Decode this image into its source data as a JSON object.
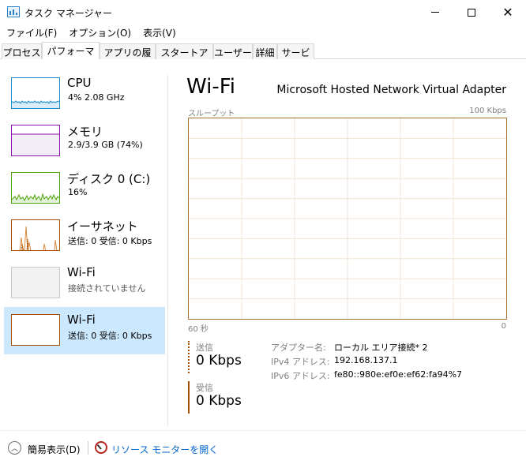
{
  "window": {
    "title": "タスク マネージャー",
    "icon": "task-manager-icon",
    "controls": {
      "minimize": "minimize-icon",
      "maximize": "maximize-icon",
      "close": "close-icon",
      "close_glyph": "✕"
    }
  },
  "menu": [
    {
      "label": "ファイル(F)"
    },
    {
      "label": "オプション(O)"
    },
    {
      "label": "表示(V)"
    }
  ],
  "tabs": [
    {
      "label": "プロセス",
      "active": false
    },
    {
      "label": "パフォーマンス",
      "active": true
    },
    {
      "label": "アプリの履歴",
      "active": false
    },
    {
      "label": "スタートアップ",
      "active": false
    },
    {
      "label": "ユーザー",
      "active": false
    },
    {
      "label": "詳細",
      "active": false
    },
    {
      "label": "サービス",
      "active": false
    }
  ],
  "sidebar": {
    "items": [
      {
        "title": "CPU",
        "subtitle": "4%  2.08 GHz",
        "color": "#1e8ecb",
        "selected": false
      },
      {
        "title": "メモリ",
        "subtitle": "2.9/3.9 GB (74%)",
        "color": "#8b12ae",
        "selected": false
      },
      {
        "title": "ディスク 0 (C:)",
        "subtitle": "16%",
        "color": "#4da60c",
        "selected": false
      },
      {
        "title": "イーサネット",
        "subtitle": "送信: 0 受信: 0 Kbps",
        "color": "#a74f01",
        "selected": false
      },
      {
        "title": "Wi-Fi",
        "subtitle": "接続されていません",
        "color": "#c8c8c8",
        "selected": false
      },
      {
        "title": "Wi-Fi",
        "subtitle": "送信: 0 受信: 0 Kbps",
        "color": "#a74f01",
        "selected": true
      }
    ]
  },
  "main": {
    "title": "Wi-Fi",
    "adapter_name": "Microsoft Hosted Network Virtual Adapter",
    "graph": {
      "label_top_left": "スループット",
      "label_top_right": "100 Kbps",
      "label_bottom_left": "60 秒",
      "label_bottom_right": "0",
      "border_color": "#a57232",
      "grid_color": "#f1e4d4"
    },
    "send": {
      "label": "送信",
      "value": "0 Kbps",
      "color": "#a74f01"
    },
    "receive": {
      "label": "受信",
      "value": "0 Kbps",
      "color": "#a74f01"
    },
    "props": [
      {
        "label": "アダプター名:",
        "value": "ローカル エリア接続* 2"
      },
      {
        "label": "IPv4 アドレス:",
        "value": "192.168.137.1"
      },
      {
        "label": "IPv6 アドレス:",
        "value": "fe80::980e:ef0e:ef62:fa94%7"
      }
    ]
  },
  "footer": {
    "fewer_details": "簡易表示(D)",
    "fewer_icon_glyph": "︿",
    "resource_monitor": "リソース モニターを開く"
  }
}
